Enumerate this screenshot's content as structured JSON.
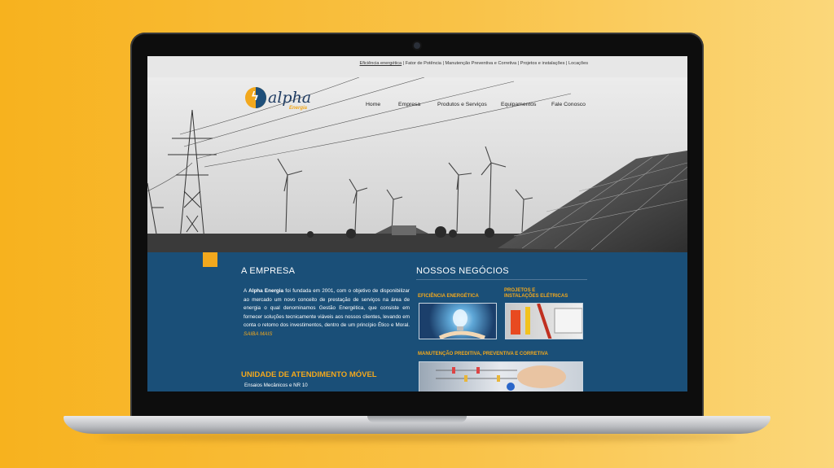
{
  "colors": {
    "accent": "#f2a81d",
    "brand_blue": "#1a4f78",
    "background": "#f9c247"
  },
  "top_links": [
    "Eficiência energética",
    "Fator de Potência",
    "Manutenção Preventiva e Corretiva",
    "Projetos e instalações",
    "Locações"
  ],
  "logo": {
    "name": "alpha",
    "sub": "Energia",
    "icon": "bolt-icon"
  },
  "nav": [
    "Home",
    "Empresa",
    "Produtos e Serviços",
    "Equipamentos",
    "Fale Conosco"
  ],
  "about": {
    "title": "A EMPRESA",
    "text_intro": "A ",
    "company": "Alpha Energia",
    "text_body": " foi fundada em 2001, com o objetivo de disponibilizar ao mercado um novo conceito de prestação de serviços na área de energia o qual denominamos Gestão Energética, que consiste em fornecer soluções tecnicamente viáveis aos nossos clientes, levando em conta o retorno dos investimentos, dentro de um princípio Ético e Moral.",
    "more_link": "SAIBA MAIS"
  },
  "mobile_unit": {
    "title": "UNIDADE DE ATENDIMENTO MÓVEL",
    "item": "Ensaios Mecânicos e NR 10"
  },
  "business": {
    "title": "NOSSOS NEGÓCIOS",
    "items": [
      {
        "label": "EFICIÊNCIA ENERGÉTICA"
      },
      {
        "label_line1": "PROJETOS E",
        "label_line2": "INSTALAÇÕES ELÉTRICAS"
      },
      {
        "label": "MANUTENÇÃO PREDITIVA, PREVENTIVA E CORRETIVA"
      }
    ]
  }
}
